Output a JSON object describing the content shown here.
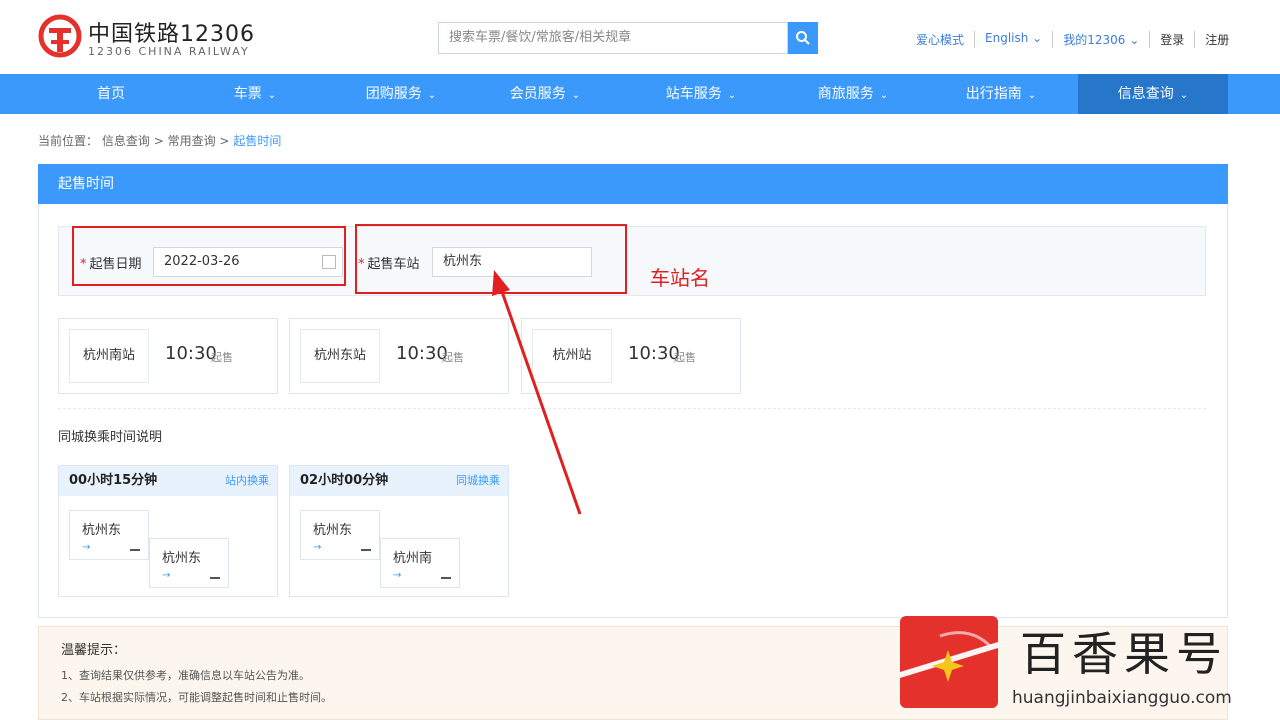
{
  "header": {
    "brand": "中国铁路12306",
    "brand_sub": "12306 CHINA RAILWAY",
    "search_placeholder": "搜索车票/餐饮/常旅客/相关规章",
    "links": [
      "爱心模式",
      "English ⌄",
      "我的12306 ⌄",
      "登录",
      "注册"
    ]
  },
  "nav": {
    "items": [
      "首页",
      "车票",
      "团购服务",
      "会员服务",
      "站车服务",
      "商旅服务",
      "出行指南",
      "信息查询"
    ],
    "active_index": 7
  },
  "breadcrumb": {
    "prefix": "当前位置：",
    "items": [
      "信息查询",
      "常用查询"
    ],
    "current": "起售时间",
    "sep": ">"
  },
  "panel": {
    "title": "起售时间",
    "date_label": "起售日期",
    "date_value": "2022-03-26",
    "station_label": "起售车站",
    "station_value": "杭州东",
    "annotation": "车站名"
  },
  "stations": [
    {
      "name": "杭州南站",
      "time": "10:30",
      "tag": "起售"
    },
    {
      "name": "杭州东站",
      "time": "10:30",
      "tag": "起售"
    },
    {
      "name": "杭州站",
      "time": "10:30",
      "tag": "起售"
    }
  ],
  "transfer": {
    "title": "同城换乘时间说明",
    "cards": [
      {
        "duration": "00小时15分钟",
        "type": "站内换乘",
        "from": "杭州东",
        "to": "杭州东"
      },
      {
        "duration": "02小时00分钟",
        "type": "同城换乘",
        "from": "杭州东",
        "to": "杭州南"
      }
    ]
  },
  "notice": {
    "title": "温馨提示：",
    "lines": [
      "1、查询结果仅供参考，准确信息以车站公告为准。",
      "2、车站根据实际情况，可能调整起售时间和止售时间。"
    ]
  },
  "watermark": {
    "text": "百香果号",
    "url": "huangjinbaixiangguo.com"
  },
  "colors": {
    "primary": "#3b99fc",
    "nav_active": "#2676c9",
    "annotation": "#e02020"
  }
}
